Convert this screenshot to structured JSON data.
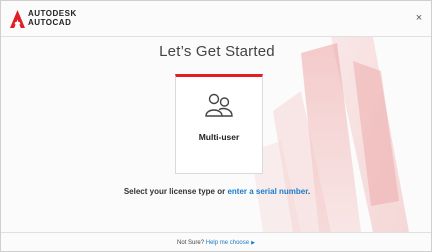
{
  "header": {
    "brand_top": "AUTODESK",
    "brand_bottom": "AUTOCAD",
    "close_symbol": "×"
  },
  "main": {
    "title": "Let’s Get Started",
    "card": {
      "label": "Multi-user",
      "icon": "users-icon",
      "accent_color": "#e01e24"
    },
    "license_prefix": "Select your license type or ",
    "license_link": "enter a serial number",
    "license_suffix": "."
  },
  "footer": {
    "prefix": "Not Sure? ",
    "link": "Help me choose",
    "arrow": "▶"
  },
  "colors": {
    "brand_red": "#e01e24",
    "link_blue": "#1a7bc8"
  }
}
